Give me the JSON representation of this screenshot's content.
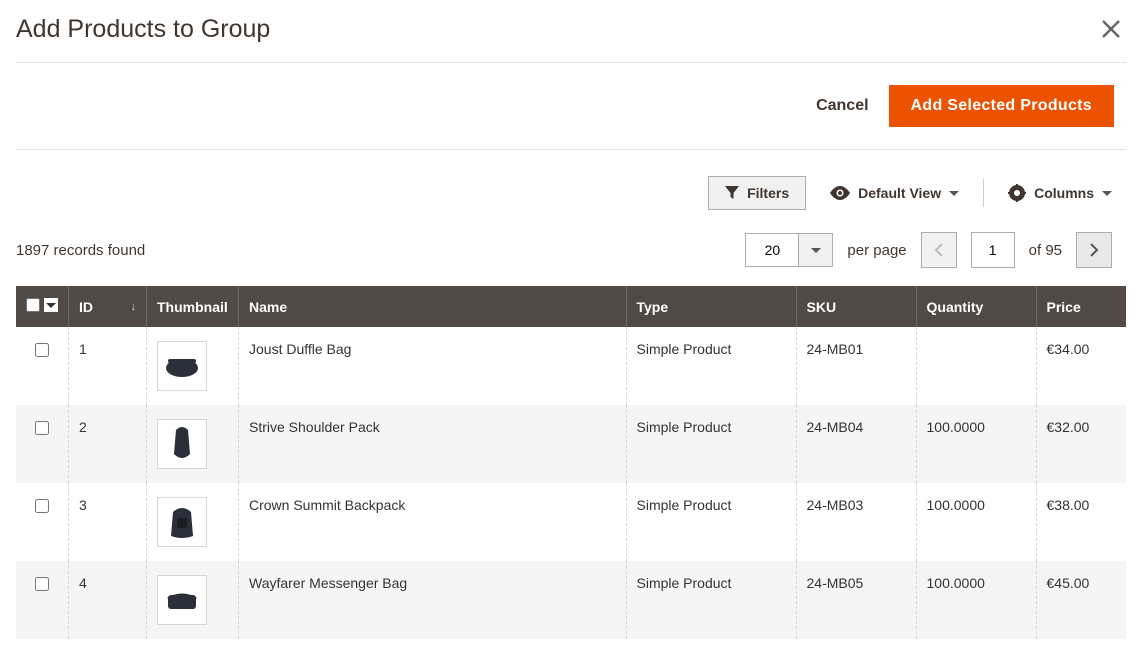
{
  "modal": {
    "title": "Add Products to Group",
    "cancel_label": "Cancel",
    "add_label": "Add Selected Products"
  },
  "toolbar": {
    "filters_label": "Filters",
    "view_label": "Default View",
    "columns_label": "Columns"
  },
  "pager": {
    "records_found": "1897 records found",
    "page_size": "20",
    "per_page_label": "per page",
    "current_page": "1",
    "of_label": "of",
    "total_pages": "95"
  },
  "columns": {
    "id": "ID",
    "thumbnail": "Thumbnail",
    "name": "Name",
    "type": "Type",
    "sku": "SKU",
    "quantity": "Quantity",
    "price": "Price"
  },
  "rows": [
    {
      "id": "1",
      "name": "Joust Duffle Bag",
      "type": "Simple Product",
      "sku": "24-MB01",
      "quantity": "",
      "price": "€34.00"
    },
    {
      "id": "2",
      "name": "Strive Shoulder Pack",
      "type": "Simple Product",
      "sku": "24-MB04",
      "quantity": "100.0000",
      "price": "€32.00"
    },
    {
      "id": "3",
      "name": "Crown Summit Backpack",
      "type": "Simple Product",
      "sku": "24-MB03",
      "quantity": "100.0000",
      "price": "€38.00"
    },
    {
      "id": "4",
      "name": "Wayfarer Messenger Bag",
      "type": "Simple Product",
      "sku": "24-MB05",
      "quantity": "100.0000",
      "price": "€45.00"
    }
  ]
}
